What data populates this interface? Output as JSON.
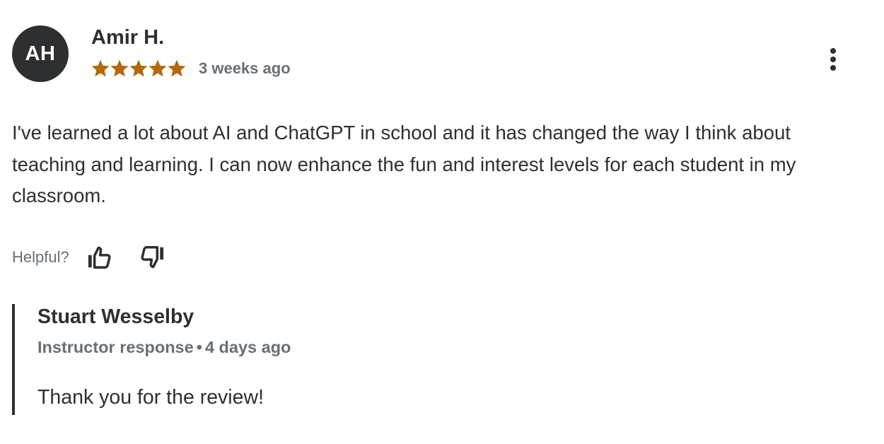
{
  "review": {
    "avatar_initials": "AH",
    "reviewer_name": "Amir H.",
    "rating": 5,
    "rating_max": 5,
    "date": "3 weeks ago",
    "text": "I've learned a lot about AI and ChatGPT in school and it has changed the way I think about teaching and learning. I can now enhance the fun and interest levels for each student in my classroom.",
    "more_icon": "more-vertical-icon"
  },
  "helpful": {
    "label": "Helpful?",
    "thumbs_up_icon": "thumbs-up-icon",
    "thumbs_down_icon": "thumbs-down-icon"
  },
  "response": {
    "instructor_name": "Stuart Wesselby",
    "role": "Instructor response",
    "separator": "•",
    "date": "4 days ago",
    "text": "Thank you for the review!"
  },
  "colors": {
    "text_primary": "#2d2f31",
    "text_secondary": "#6a6f73",
    "star": "#b4690e",
    "avatar_bg": "#2d2f31",
    "avatar_text": "#ffffff"
  }
}
